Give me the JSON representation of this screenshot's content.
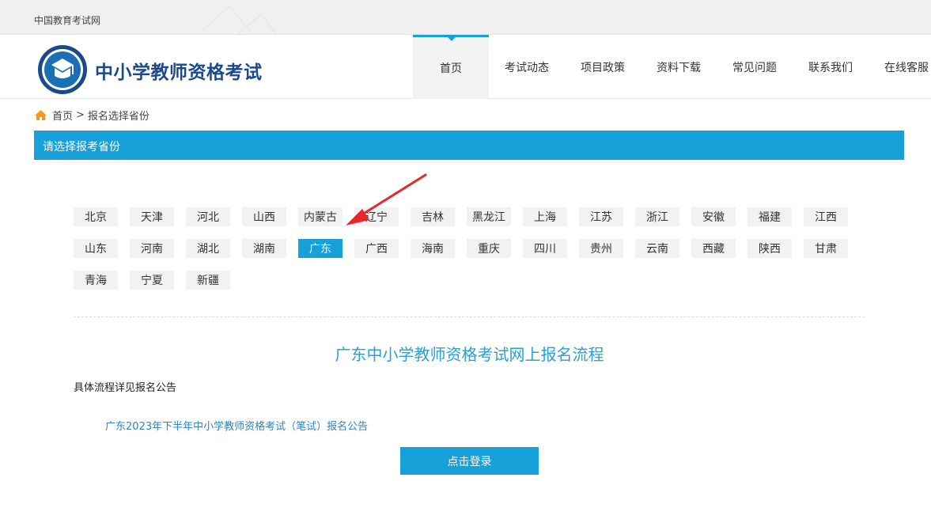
{
  "topbar": {
    "site_name": "中国教育考试网"
  },
  "header": {
    "brand": "中小学教师资格考试",
    "nav": [
      {
        "label": "首页",
        "active": true
      },
      {
        "label": "考试动态"
      },
      {
        "label": "项目政策"
      },
      {
        "label": "资料下载"
      },
      {
        "label": "常见问题"
      },
      {
        "label": "联系我们"
      },
      {
        "label": "在线客服"
      }
    ]
  },
  "breadcrumb": {
    "home": "首页",
    "separator": ">",
    "current": "报名选择省份"
  },
  "section": {
    "title": "请选择报考省份"
  },
  "provinces": [
    "北京",
    "天津",
    "河北",
    "山西",
    "内蒙古",
    "辽宁",
    "吉林",
    "黑龙江",
    "上海",
    "江苏",
    "浙江",
    "安徽",
    "福建",
    "江西",
    "山东",
    "河南",
    "湖北",
    "湖南",
    "广东",
    "广西",
    "海南",
    "重庆",
    "四川",
    "贵州",
    "云南",
    "西藏",
    "陕西",
    "甘肃",
    "青海",
    "宁夏",
    "新疆"
  ],
  "selected_province": "广东",
  "flow": {
    "title": "广东中小学教师资格考试网上报名流程",
    "note": "具体流程详见报名公告",
    "notice_link": "广东2023年下半年中小学教师资格考试（笔试）报名公告",
    "login_button": "点击登录"
  },
  "colors": {
    "accent": "#17a1d8",
    "brand": "#1a4a8c",
    "annotation_arrow": "#e8262b"
  }
}
